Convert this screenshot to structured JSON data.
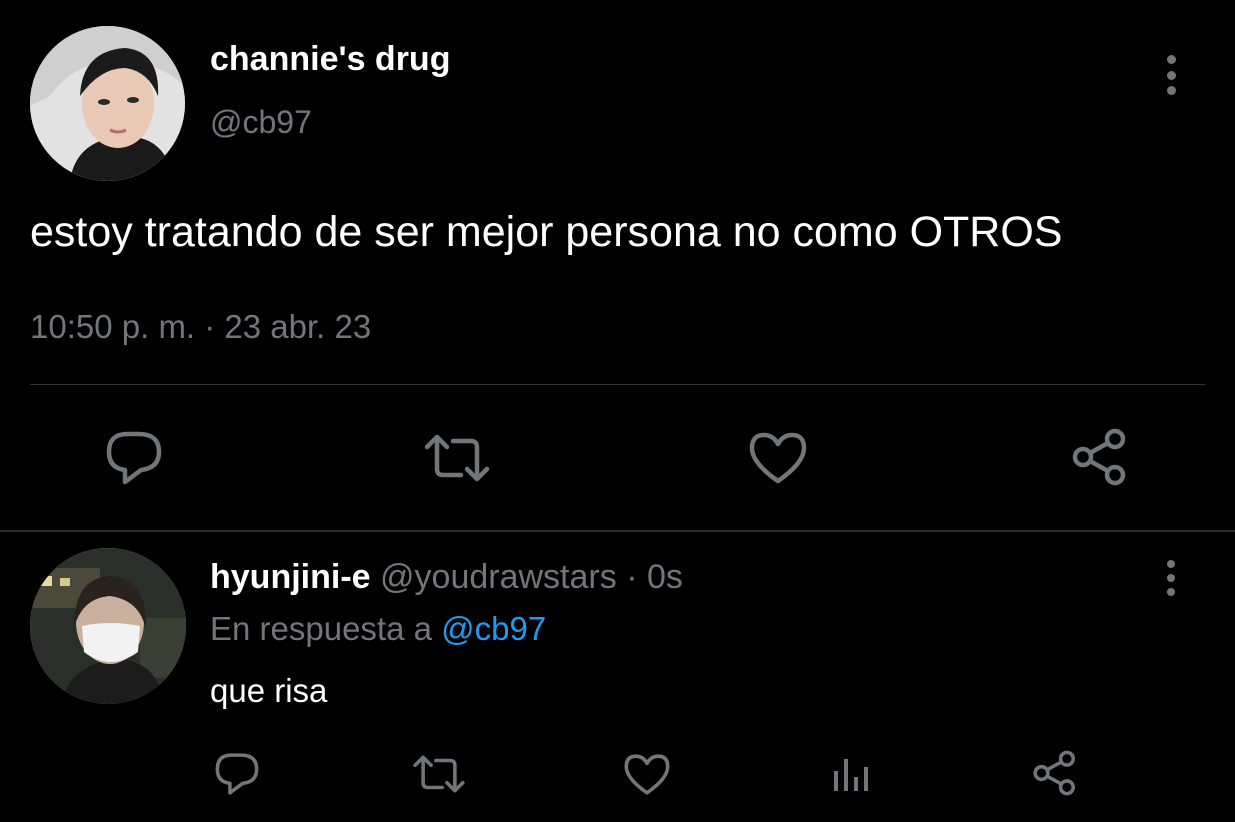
{
  "main_tweet": {
    "display_name": "channie's drug",
    "handle": "@cb97",
    "text": "estoy tratando de ser mejor persona no como OTROS",
    "timestamp": "10:50 p. m. · 23 abr. 23",
    "actions": [
      "reply-icon",
      "retweet-icon",
      "like-icon",
      "share-icon"
    ]
  },
  "reply": {
    "display_name": "hyunjini-e",
    "handle": "@youdrawstars",
    "separator": "·",
    "time": "0s",
    "replying_prefix": "En respuesta a",
    "replying_to": "@cb97",
    "text": "que risa",
    "actions": [
      "reply-icon",
      "retweet-icon",
      "like-icon",
      "analytics-icon",
      "share-icon"
    ]
  },
  "colors": {
    "background": "#000000",
    "primary_text": "#ffffff",
    "secondary_text": "#71767b",
    "accent": "#1d9bf0",
    "divider": "#2f3336"
  }
}
